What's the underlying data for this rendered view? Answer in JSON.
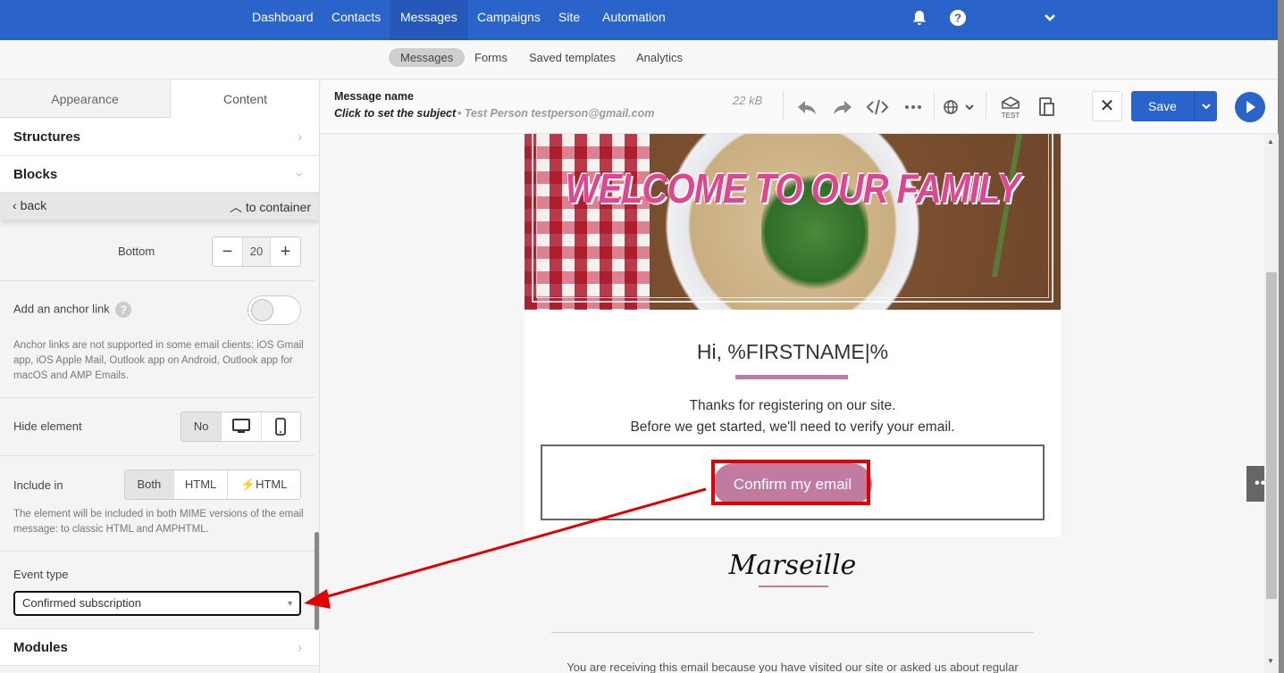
{
  "topnav": {
    "items": [
      {
        "label": "Dashboard",
        "active": false
      },
      {
        "label": "Contacts",
        "active": false
      },
      {
        "label": "Messages",
        "active": true
      },
      {
        "label": "Campaigns",
        "active": false
      },
      {
        "label": "Site",
        "active": false
      },
      {
        "label": "Automation",
        "active": false
      }
    ],
    "icons": [
      "bell-icon",
      "help-icon",
      "chevron-down-icon"
    ]
  },
  "subnav": {
    "items": [
      {
        "label": "Messages",
        "active": true
      },
      {
        "label": "Forms",
        "active": false
      },
      {
        "label": "Saved templates",
        "active": false
      },
      {
        "label": "Analytics",
        "active": false
      }
    ]
  },
  "sidebar": {
    "tabs": [
      {
        "label": "Appearance",
        "active": false
      },
      {
        "label": "Content",
        "active": true
      }
    ],
    "sections": {
      "structures": "Structures",
      "blocks": "Blocks",
      "modules": "Modules"
    },
    "backbar": {
      "back_label": "back",
      "to_container_label": "to container"
    },
    "padding_bottom": {
      "label": "Bottom",
      "value": "20",
      "minus": "−",
      "plus": "+"
    },
    "anchor_link": {
      "label": "Add an anchor link",
      "help": "?",
      "enabled": false,
      "note": "Anchor links are not supported in some email clients: iOS Gmail app, iOS Apple Mail, Outlook app on Android, Outlook app for macOS and AMP Emails."
    },
    "hide_element": {
      "label": "Hide element",
      "options": [
        "No",
        "desktop",
        "mobile"
      ],
      "selected": "No"
    },
    "include_in": {
      "label": "Include in",
      "options": [
        "Both",
        "HTML",
        "HTML"
      ],
      "selected": "Both",
      "note": "The element will be included in both MIME versions of the email message: to classic HTML and AMPHTML."
    },
    "event_type": {
      "label": "Event type",
      "value": "Confirmed subscription"
    }
  },
  "editor_header": {
    "message_name": "Message name",
    "subject": "Click to set the subject",
    "sender": "• Test Person testperson@gmail.com",
    "size": "22 kB",
    "test_label": "TEST",
    "save_label": "Save"
  },
  "email": {
    "banner_headline": "WELCOME TO OUR FAMILY",
    "greeting": "Hi, %FIRSTNAME|%",
    "thanks_line1": "Thanks for registering on our site.",
    "thanks_line2": "Before we get started, we'll need to verify your email.",
    "button_label": "Confirm my email",
    "brand": "Marseille",
    "footer_text": "You are receiving this email because you have visited our site or asked us about regular",
    "accent_color": "#c27ba0"
  },
  "colors": {
    "brand_blue": "#2a64cb",
    "annotation_red": "#e00000"
  }
}
